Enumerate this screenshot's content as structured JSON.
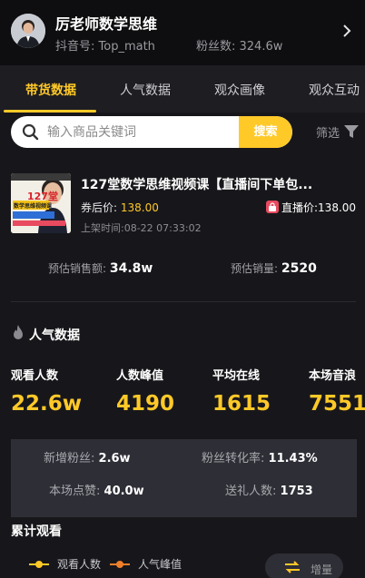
{
  "header": {
    "anchor_name": "厉老师数学思维",
    "douyin_id": "抖音号: Top_math",
    "fans": "粉丝数: 324.6w"
  },
  "tabs": [
    {
      "label": "带货数据",
      "active": true
    },
    {
      "label": "人气数据",
      "active": false
    },
    {
      "label": "观众画像",
      "active": false
    },
    {
      "label": "观众互动",
      "active": false
    }
  ],
  "search": {
    "placeholder": "输入商品关键词",
    "button_label": "搜索",
    "filter_label": "筛选"
  },
  "product": {
    "thumb_text": "127堂",
    "thumb_subtitle": "数学思维视频课",
    "title": "127堂数学思维视频课【直播间下单包...",
    "coupon_price_label": "券后价:",
    "coupon_price": "138.00",
    "live_price": "直播价:138.00",
    "listed_time": "上架时间:08-22 07:33:02",
    "est_sales_amount_label": "预估销售额:",
    "est_sales_amount": "34.8w",
    "est_sales_volume_label": "预估销量:",
    "est_sales_volume": "2520"
  },
  "popularity": {
    "title": "人气数据",
    "metrics": [
      {
        "label": "观看人数",
        "value": "22.6w"
      },
      {
        "label": "人数峰值",
        "value": "4190"
      },
      {
        "label": "平均在线",
        "value": "1615"
      },
      {
        "label": "本场音浪",
        "value": "7551"
      }
    ],
    "stats": [
      {
        "label": "新增粉丝:",
        "value": "2.6w"
      },
      {
        "label": "粉丝转化率:",
        "value": "11.43%"
      },
      {
        "label": "本场点赞:",
        "value": "40.0w"
      },
      {
        "label": "送礼人数:",
        "value": "1753"
      }
    ]
  },
  "cumulative": {
    "title": "累计观看",
    "legend": [
      "观看人数",
      "人气峰值"
    ],
    "increment_label": "增量"
  },
  "colors": {
    "accent": "#ffc928",
    "legend_viewers": "#ffc928",
    "legend_peak": "#f07f2a"
  }
}
